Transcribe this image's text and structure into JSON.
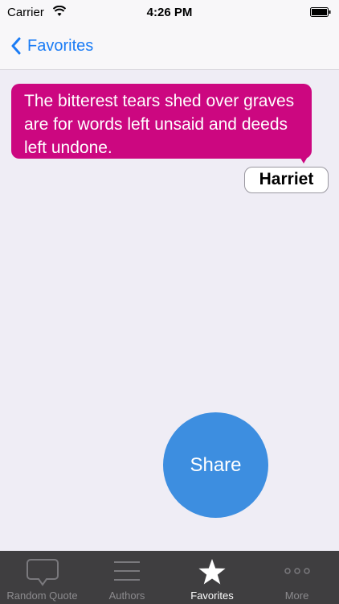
{
  "status_bar": {
    "carrier": "Carrier",
    "time": "4:26 PM"
  },
  "nav": {
    "back_label": "Favorites"
  },
  "quote": {
    "text": "The bitterest tears shed over graves are for words left unsaid and deeds left undone.",
    "author": "Harriet",
    "bubble_color": "#cc0780"
  },
  "share": {
    "label": "Share",
    "color": "#3d8ee0"
  },
  "tabs": [
    {
      "label": "Random Quote",
      "icon": "speech-bubble-icon"
    },
    {
      "label": "Authors",
      "icon": "list-icon"
    },
    {
      "label": "Favorites",
      "icon": "star-icon",
      "active": true
    },
    {
      "label": "More",
      "icon": "more-dots-icon"
    }
  ]
}
